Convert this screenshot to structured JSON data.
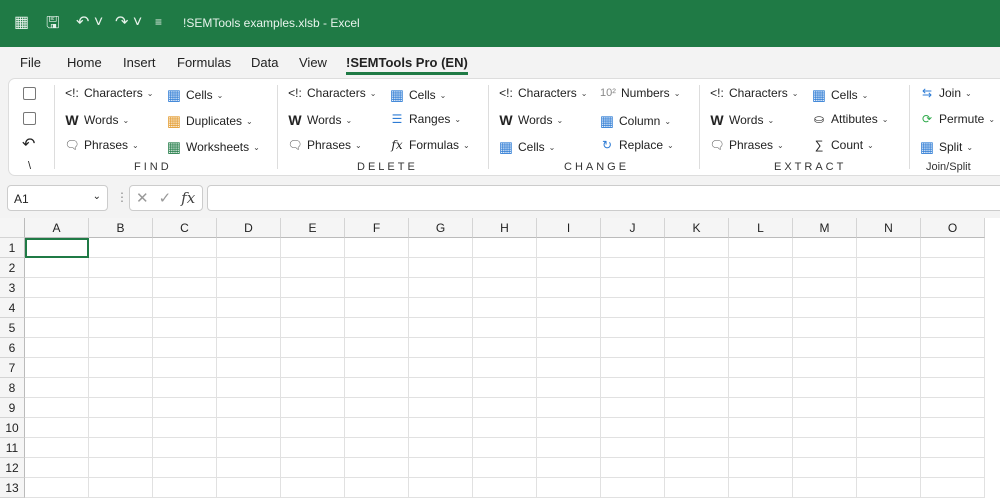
{
  "titlebar": {
    "title": "!SEMTools examples.xlsb  -  Excel"
  },
  "tabs": [
    "File",
    "Home",
    "Insert",
    "Formulas",
    "Data",
    "View",
    "!SEMTools Pro (EN)"
  ],
  "active_tab": "!SEMTools Pro (EN)",
  "ribbon": {
    "left_misc": [
      "\\"
    ],
    "groups": [
      {
        "label": "FIND",
        "columns": [
          [
            {
              "icon": "characters-icon",
              "label": "Characters"
            },
            {
              "icon": "words-icon",
              "label": "Words"
            },
            {
              "icon": "phrases-icon",
              "label": "Phrases"
            }
          ],
          [
            {
              "icon": "cells-icon",
              "label": "Cells"
            },
            {
              "icon": "duplicates-icon",
              "label": "Duplicates"
            },
            {
              "icon": "worksheets-icon",
              "label": "Worksheets"
            }
          ]
        ]
      },
      {
        "label": "DELETE",
        "columns": [
          [
            {
              "icon": "characters-icon",
              "label": "Characters"
            },
            {
              "icon": "words-icon",
              "label": "Words"
            },
            {
              "icon": "phrases-icon",
              "label": "Phrases"
            }
          ],
          [
            {
              "icon": "cells-icon",
              "label": "Cells"
            },
            {
              "icon": "ranges-icon",
              "label": "Ranges"
            },
            {
              "icon": "formulas-icon",
              "label": "Formulas"
            }
          ]
        ]
      },
      {
        "label": "CHANGE",
        "columns": [
          [
            {
              "icon": "characters-icon",
              "label": "Characters"
            },
            {
              "icon": "words-icon",
              "label": "Words"
            },
            {
              "icon": "cells-icon",
              "label": "Cells"
            }
          ],
          [
            {
              "icon": "numbers-icon",
              "label": "Numbers"
            },
            {
              "icon": "column-icon",
              "label": "Column"
            },
            {
              "icon": "replace-icon",
              "label": "Replace"
            }
          ]
        ]
      },
      {
        "label": "EXTRACT",
        "columns": [
          [
            {
              "icon": "characters-icon",
              "label": "Characters"
            },
            {
              "icon": "words-icon",
              "label": "Words"
            },
            {
              "icon": "phrases-icon",
              "label": "Phrases"
            }
          ],
          [
            {
              "icon": "cells-icon",
              "label": "Cells"
            },
            {
              "icon": "attributes-icon",
              "label": "Attibutes"
            },
            {
              "icon": "sum-icon",
              "label": "Count"
            }
          ]
        ]
      },
      {
        "label": "Join/Split",
        "columns": [
          [
            {
              "icon": "join-icon",
              "label": "Join"
            },
            {
              "icon": "permute-icon",
              "label": "Permute"
            },
            {
              "icon": "split-icon",
              "label": "Split"
            }
          ]
        ]
      }
    ]
  },
  "formula_bar": {
    "name_box": "A1",
    "formula": ""
  },
  "columns": [
    "A",
    "B",
    "C",
    "D",
    "E",
    "F",
    "G",
    "H",
    "I",
    "J",
    "K",
    "L",
    "M",
    "N",
    "O"
  ],
  "rows": [
    "1",
    "2",
    "3",
    "4",
    "5",
    "6",
    "7",
    "8",
    "9",
    "10",
    "11",
    "12",
    "13"
  ],
  "colors": {
    "accent": "#1f7a45"
  }
}
